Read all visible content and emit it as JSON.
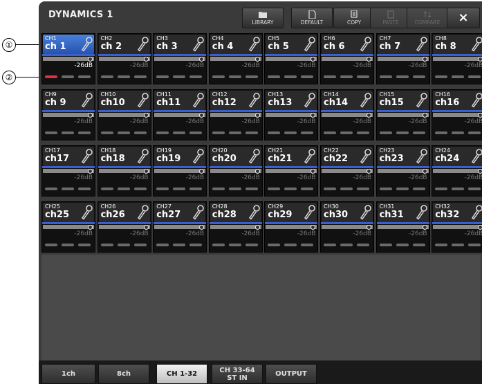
{
  "window": {
    "title": "DYNAMICS 1"
  },
  "toolbar": {
    "library": "LIBRARY",
    "default": "DEFAULT",
    "copy": "COPY",
    "paste": "PASTE",
    "compare": "COMPARE",
    "close": "×"
  },
  "channels": [
    {
      "num": "CH1",
      "name": "ch 1",
      "thresh": "-26dB"
    },
    {
      "num": "CH2",
      "name": "ch 2",
      "thresh": "-26dB"
    },
    {
      "num": "CH3",
      "name": "ch 3",
      "thresh": "-26dB"
    },
    {
      "num": "CH4",
      "name": "ch 4",
      "thresh": "-26dB"
    },
    {
      "num": "CH5",
      "name": "ch 5",
      "thresh": "-26dB"
    },
    {
      "num": "CH6",
      "name": "ch 6",
      "thresh": "-26dB"
    },
    {
      "num": "CH7",
      "name": "ch 7",
      "thresh": "-26dB"
    },
    {
      "num": "CH8",
      "name": "ch 8",
      "thresh": "-26dB"
    },
    {
      "num": "CH9",
      "name": "ch 9",
      "thresh": "-26dB"
    },
    {
      "num": "CH10",
      "name": "ch10",
      "thresh": "-26dB"
    },
    {
      "num": "CH11",
      "name": "ch11",
      "thresh": "-26dB"
    },
    {
      "num": "CH12",
      "name": "ch12",
      "thresh": "-26dB"
    },
    {
      "num": "CH13",
      "name": "ch13",
      "thresh": "-26dB"
    },
    {
      "num": "CH14",
      "name": "ch14",
      "thresh": "-26dB"
    },
    {
      "num": "CH15",
      "name": "ch15",
      "thresh": "-26dB"
    },
    {
      "num": "CH16",
      "name": "ch16",
      "thresh": "-26dB"
    },
    {
      "num": "CH17",
      "name": "ch17",
      "thresh": "-26dB"
    },
    {
      "num": "CH18",
      "name": "ch18",
      "thresh": "-26dB"
    },
    {
      "num": "CH19",
      "name": "ch19",
      "thresh": "-26dB"
    },
    {
      "num": "CH20",
      "name": "ch20",
      "thresh": "-26dB"
    },
    {
      "num": "CH21",
      "name": "ch21",
      "thresh": "-26dB"
    },
    {
      "num": "CH22",
      "name": "ch22",
      "thresh": "-26dB"
    },
    {
      "num": "CH23",
      "name": "ch23",
      "thresh": "-26dB"
    },
    {
      "num": "CH24",
      "name": "ch24",
      "thresh": "-26dB"
    },
    {
      "num": "CH25",
      "name": "ch25",
      "thresh": "-26dB"
    },
    {
      "num": "CH26",
      "name": "ch26",
      "thresh": "-26dB"
    },
    {
      "num": "CH27",
      "name": "ch27",
      "thresh": "-26dB"
    },
    {
      "num": "CH28",
      "name": "ch28",
      "thresh": "-26dB"
    },
    {
      "num": "CH29",
      "name": "ch29",
      "thresh": "-26dB"
    },
    {
      "num": "CH30",
      "name": "ch30",
      "thresh": "-26dB"
    },
    {
      "num": "CH31",
      "name": "ch31",
      "thresh": "-26dB"
    },
    {
      "num": "CH32",
      "name": "ch32",
      "thresh": "-26dB"
    }
  ],
  "tabs": [
    {
      "label": "1ch",
      "active": false
    },
    {
      "label": "8ch",
      "active": false
    },
    {
      "label": "CH 1-32",
      "active": true
    },
    {
      "label": "CH 33-64",
      "sub": "ST IN",
      "active": false
    },
    {
      "label": "OUTPUT",
      "active": false
    }
  ],
  "callouts": [
    "①",
    "②"
  ],
  "colors": {
    "accent": "#3b5fd0",
    "selected": "#2f63c8",
    "led_active": "#e0303a"
  }
}
